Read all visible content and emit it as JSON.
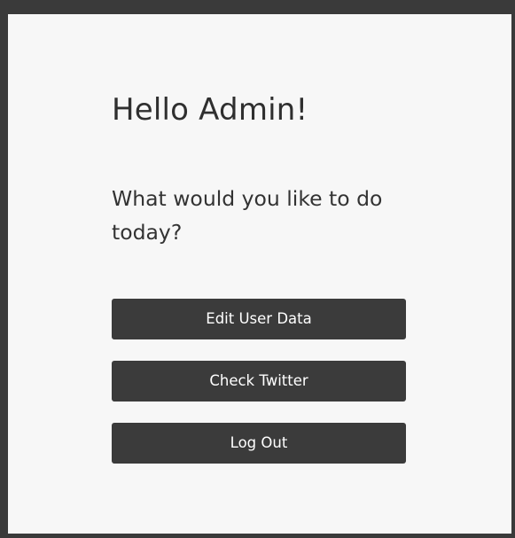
{
  "greeting": "Hello Admin!",
  "prompt": "What would you like to do today?",
  "actions": {
    "edit_user_data": "Edit User Data",
    "check_twitter": "Check Twitter",
    "log_out": "Log Out"
  },
  "colors": {
    "frame": "#3a3a3a",
    "panel": "#f7f7f7",
    "button_bg": "#3b3b3b",
    "button_text": "#ffffff"
  }
}
